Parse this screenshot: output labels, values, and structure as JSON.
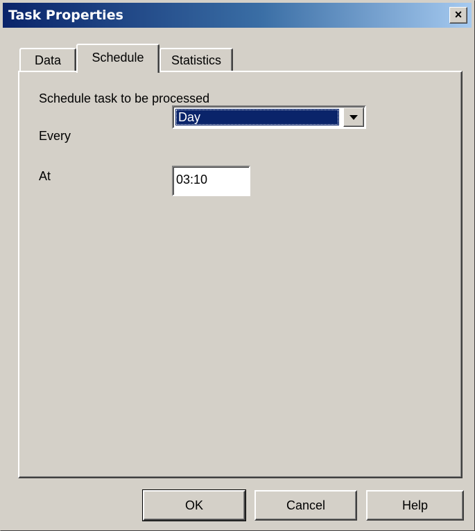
{
  "window": {
    "title": "Task Properties",
    "close_label": "×"
  },
  "tabs": [
    {
      "label": "Data",
      "active": false
    },
    {
      "label": "Schedule",
      "active": true
    },
    {
      "label": "Statistics",
      "active": false
    }
  ],
  "schedule": {
    "heading": "Schedule task to be processed",
    "every_label": "Every",
    "every_value": "Day",
    "at_label": "At",
    "at_value": "03:10"
  },
  "buttons": {
    "ok": "OK",
    "cancel": "Cancel",
    "help": "Help"
  },
  "colors": {
    "title_start": "#0a246a",
    "title_end": "#a6caf0",
    "face": "#d4d0c8",
    "selection": "#0a246a"
  }
}
